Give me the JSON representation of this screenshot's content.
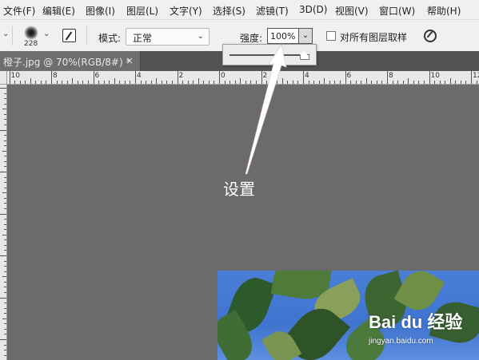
{
  "menubar": {
    "items": [
      {
        "label": "文件(F)"
      },
      {
        "label": "编辑(E)"
      },
      {
        "label": "图像(I)"
      },
      {
        "label": "图层(L)"
      },
      {
        "label": "文字(Y)"
      },
      {
        "label": "选择(S)"
      },
      {
        "label": "滤镜(T)"
      },
      {
        "label": "3D(D)"
      },
      {
        "label": "视图(V)"
      },
      {
        "label": "窗口(W)"
      },
      {
        "label": "帮助(H)"
      }
    ]
  },
  "options": {
    "brush_size": "228",
    "mode_label": "模式:",
    "mode_value": "正常",
    "strength_label": "强度:",
    "strength_value": "100%",
    "strength_fraction": 1.0,
    "sample_all_layers_label": "对所有图层取样",
    "sample_all_layers_checked": false
  },
  "document_tab": {
    "title": "橙子.jpg @ 70%(RGB/8#) *",
    "close_glyph": "×"
  },
  "ruler": {
    "labels": [
      "10",
      "8",
      "6",
      "4",
      "2",
      "0",
      "2",
      "4",
      "6",
      "8",
      "10",
      "12"
    ]
  },
  "annotation": {
    "label": "设置",
    "color": "#ffffff"
  },
  "watermark": {
    "brand": "Bai du 经验",
    "url": "jingyan.baidu.com"
  }
}
